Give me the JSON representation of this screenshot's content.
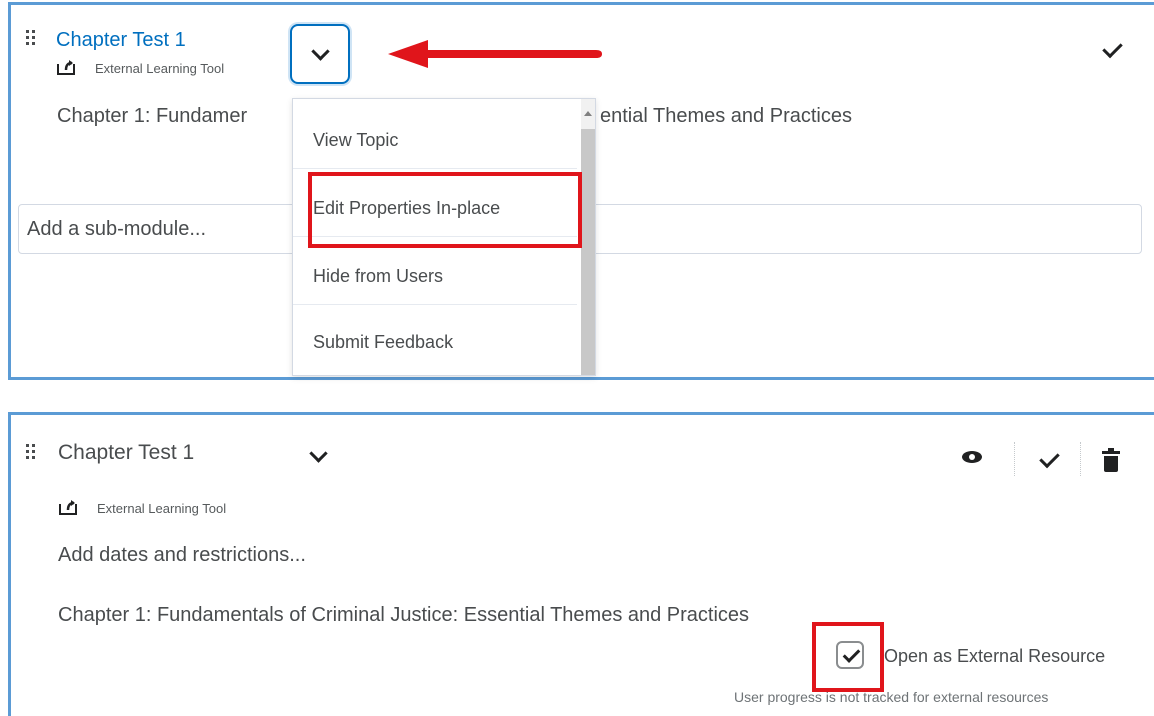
{
  "top_panel": {
    "title": "Chapter Test 1",
    "tool_label": "External Learning Tool",
    "description_left": "Chapter 1: Fundamer",
    "description_right": "ential Themes and Practices",
    "submodule_placeholder": "Add a sub-module...",
    "dropdown_menu": {
      "items": [
        {
          "label": "View Topic"
        },
        {
          "label": "Edit Properties In-place"
        },
        {
          "label": "Hide from Users"
        },
        {
          "label": "Submit Feedback"
        }
      ],
      "highlighted_item": "Edit Properties In-place"
    }
  },
  "bottom_panel": {
    "title": "Chapter Test 1",
    "tool_label": "External Learning Tool",
    "dates_link": "Add dates and restrictions...",
    "description": "Chapter 1: Fundamentals of Criminal Justice: Essential Themes and Practices",
    "external_resource_label": "Open as External Resource",
    "external_resource_checked": true,
    "progress_note": "User progress is not tracked for external resources"
  },
  "colors": {
    "link_blue": "#006fbf",
    "panel_border": "#5b9bd5",
    "annotation_red": "#e0151b",
    "text": "#494c4e"
  },
  "icons": [
    "drag-handle-icon",
    "external-tool-icon",
    "chevron-down-icon",
    "checkmark-icon",
    "eye-icon",
    "trash-icon",
    "annotation-arrow-icon"
  ]
}
